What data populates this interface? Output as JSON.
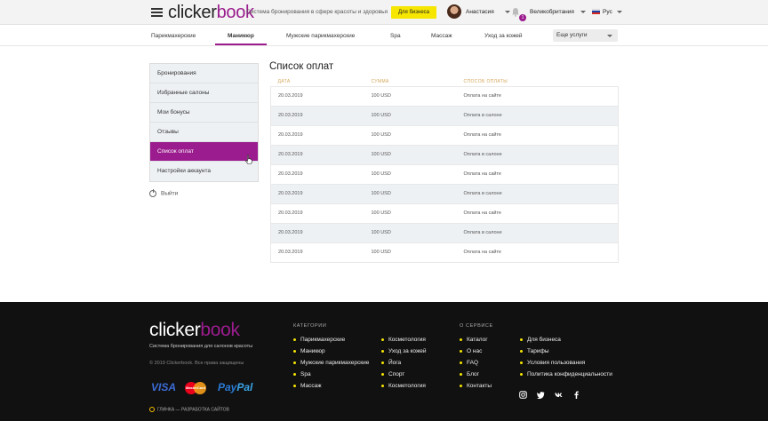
{
  "header": {
    "logo_part1": "clicker",
    "logo_part2": "book",
    "tagline": "Система бронирования в сфере красоты и здоровья",
    "business_button": "Для бизнеса",
    "user_name": "Анастасия",
    "notification_count": "1",
    "country": "Великобритания",
    "language": "Рус",
    "brand_color": "#9b1c8e",
    "accent_color": "#f6e600"
  },
  "categories": {
    "items": [
      "Парикмахерские",
      "Маникюр",
      "Мужские парикмахерские",
      "Spa",
      "Массаж",
      "Уход за кожей"
    ],
    "active": "Маникюр",
    "services_select": "Еще услуги"
  },
  "sidebar": {
    "items": [
      "Бронирования",
      "Избранные салоны",
      "Мои бонусы",
      "Отзывы",
      "Список оплат",
      "Настройки аккаунта"
    ],
    "active": "Список оплат",
    "logout": "Выйти"
  },
  "payments": {
    "title": "Список оплат",
    "columns": [
      "Дата",
      "Сумма",
      "Способ оплаты"
    ],
    "rows": [
      [
        "20.03.2019",
        "100 USD",
        "Оплата на сайте"
      ],
      [
        "20.03.2019",
        "100 USD",
        "Оплата в салоне"
      ],
      [
        "20.03.2019",
        "100 USD",
        "Оплата на сайте"
      ],
      [
        "20.03.2019",
        "100 USD",
        "Оплата в салоне"
      ],
      [
        "20.03.2019",
        "100 USD",
        "Оплата на сайте"
      ],
      [
        "20.03.2019",
        "100 USD",
        "Оплата в салоне"
      ],
      [
        "20.03.2019",
        "100 USD",
        "Оплата на сайте"
      ],
      [
        "20.03.2019",
        "100 USD",
        "Оплата в салоне"
      ],
      [
        "20.03.2019",
        "100 USD",
        "Оплата на сайте"
      ]
    ]
  },
  "footer": {
    "logo_part1": "clicker",
    "logo_part2": "book",
    "subtitle": "Система бронирования для салонов красоты",
    "copyright": "© 2019 Clickerbook. Все права защищены",
    "payment_logos": [
      "VISA",
      "MasterCard",
      "PayPal"
    ],
    "mastercard_label": "MasterCard",
    "visa_label": "VISA",
    "paypal_part1": "Pay",
    "paypal_part2": "Pal",
    "developer": "ГЛИНКА — РАЗРАБОТКА САЙТОВ",
    "categories_heading": "КАТЕГОРИИ",
    "categories_col1": [
      "Парикмахерские",
      "Маникюр",
      "Мужские парикмахерские",
      "Spa",
      "Массаж"
    ],
    "categories_col2": [
      "Косметология",
      "Уход за кожей",
      "Йога",
      "Спорт",
      "Косметология"
    ],
    "about_heading": "О СЕРВИСЕ",
    "about_col1": [
      "Каталог",
      "О нас",
      "FAQ",
      "Блог",
      "Контакты"
    ],
    "about_col2": [
      "Для бизнеса",
      "Тарифы",
      "Условия пользования",
      "Политика конфиденциальности"
    ],
    "social_icons": [
      "instagram-icon",
      "twitter-icon",
      "vk-icon",
      "facebook-icon"
    ]
  }
}
